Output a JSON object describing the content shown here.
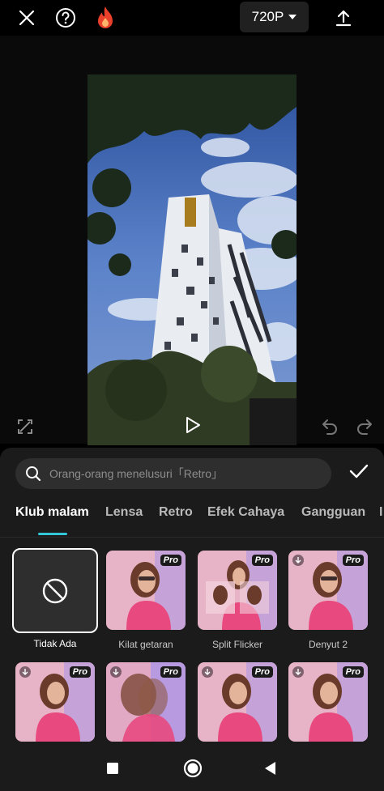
{
  "topbar": {
    "resolution_label": "720P"
  },
  "search": {
    "placeholder": "Orang-orang menelusuri「Retro」"
  },
  "tabs": [
    {
      "label": "Klub malam",
      "active": true
    },
    {
      "label": "Lensa",
      "active": false
    },
    {
      "label": "Retro",
      "active": false
    },
    {
      "label": "Efek Cahaya",
      "active": false
    },
    {
      "label": "Gangguan",
      "active": false
    },
    {
      "label": "I",
      "active": false
    }
  ],
  "effects": [
    {
      "label": "Tidak Ada",
      "selected": true,
      "pro": false,
      "download": false
    },
    {
      "label": "Kilat getaran",
      "selected": false,
      "pro": true,
      "badge": "Pro",
      "download": false
    },
    {
      "label": "Split Flicker",
      "selected": false,
      "pro": true,
      "badge": "Pro",
      "download": false
    },
    {
      "label": "Denyut 2",
      "selected": false,
      "pro": true,
      "badge": "Pro",
      "download": true
    },
    {
      "label": "",
      "pro": true,
      "badge": "Pro",
      "download": true
    },
    {
      "label": "",
      "pro": true,
      "badge": "Pro",
      "download": true
    },
    {
      "label": "",
      "pro": true,
      "badge": "Pro",
      "download": true
    },
    {
      "label": "",
      "pro": true,
      "badge": "Pro",
      "download": true
    }
  ],
  "colors": {
    "accent": "#32c6d6",
    "fire": "#e8402a",
    "panel_bg": "#1b1b1b"
  },
  "icons": {
    "close": "close-icon",
    "help": "help-icon",
    "fire": "fire-icon",
    "export": "export-icon",
    "fullscreen": "fullscreen-icon",
    "play": "play-icon",
    "undo": "undo-icon",
    "redo": "redo-icon",
    "search": "search-icon",
    "confirm": "check-icon",
    "none": "no-effect-icon"
  }
}
